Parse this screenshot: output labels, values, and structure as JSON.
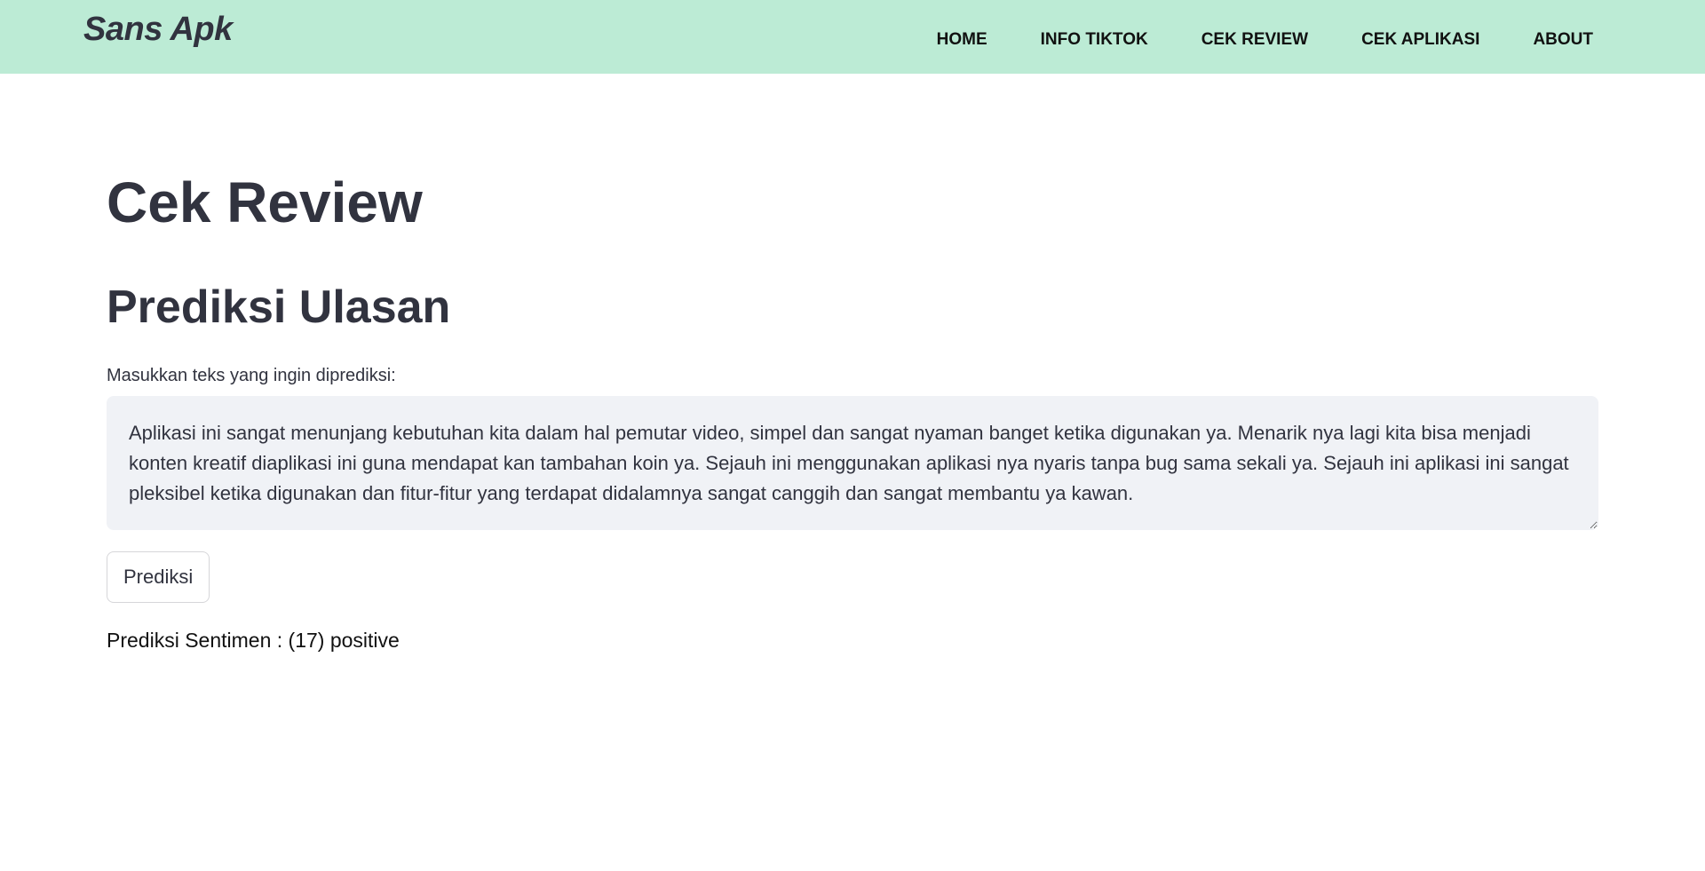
{
  "navbar": {
    "brand": "Sans Apk",
    "links": [
      {
        "label": "HOME"
      },
      {
        "label": "INFO TIKTOK"
      },
      {
        "label": "CEK REVIEW"
      },
      {
        "label": "CEK APLIKASI"
      },
      {
        "label": "ABOUT"
      }
    ],
    "background_color": "#bcebd5"
  },
  "main": {
    "page_title": "Cek Review",
    "section_title": "Prediksi Ulasan",
    "input_label": "Masukkan teks yang ingin diprediksi:",
    "review_text": "Aplikasi ini sangat menunjang kebutuhan kita dalam hal pemutar video, simpel dan sangat nyaman banget ketika digunakan ya. Menarik nya lagi kita bisa menjadi konten kreatif diaplikasi ini guna mendapat kan tambahan koin ya. Sejauh ini menggunakan aplikasi nya nyaris tanpa bug sama sekali ya. Sejauh ini aplikasi ini sangat pleksibel ketika digunakan dan fitur-fitur yang terdapat didalamnya sangat canggih dan sangat membantu ya kawan.",
    "predict_button_label": "Prediksi",
    "result_text": "Prediksi Sentimen : (17) positive"
  }
}
